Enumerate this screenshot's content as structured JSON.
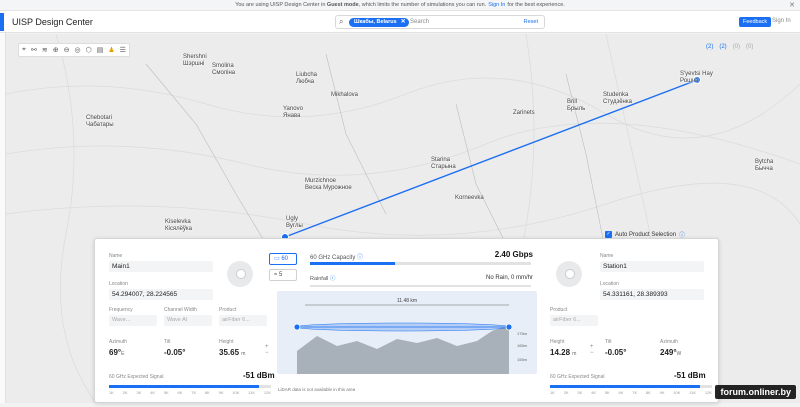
{
  "banner": {
    "prefix": "You are using UISP Design Center in",
    "mode": "Guest mode",
    "middle": ", which limits the number of simulations you can run.",
    "signin": "Sign In",
    "suffix": "for the best experience."
  },
  "app": {
    "title": "UISP Design Center",
    "feedback": "Feedback",
    "user": "Sign In"
  },
  "search": {
    "chip": "Шкабы, Belarus",
    "placeholder": "Search",
    "reset": "Reset"
  },
  "layers": [
    "(2)",
    "(2)",
    "(0)",
    "(0)"
  ],
  "places": [
    {
      "name": "Shershni",
      "alt": "Шэршні"
    },
    {
      "name": "Smolina",
      "alt": "Смоліна"
    },
    {
      "name": "Liubcha",
      "alt": "Любча"
    },
    {
      "name": "Mikhalova",
      "alt": "Міхалова"
    },
    {
      "name": "Yanovo",
      "alt": "Янава"
    },
    {
      "name": "Chebotari",
      "alt": "Чабатары"
    },
    {
      "name": "Zarinets",
      "alt": ""
    },
    {
      "name": "Brill",
      "alt": "Брыль"
    },
    {
      "name": "Studenka",
      "alt": "Студзёнка"
    },
    {
      "name": "S'yevtsi Hay",
      "alt": "Рошча"
    },
    {
      "name": "Starina",
      "alt": "Старына"
    },
    {
      "name": "Korneevka",
      "alt": ""
    },
    {
      "name": "Murzichnoe",
      "alt": "Веска Мурожное"
    },
    {
      "name": "Bytcha",
      "alt": "Бычча"
    },
    {
      "name": "Kiselevka",
      "alt": "Кісялёўка"
    },
    {
      "name": "Ugly",
      "alt": "Вуглы"
    }
  ],
  "panel": {
    "autoselect": "Auto Product Selection",
    "left": {
      "name_label": "Name",
      "name": "Main1",
      "location_label": "Location",
      "location": "54.294007, 28.224565",
      "freq_label": "Frequency",
      "freq": "Wave...",
      "width_label": "Channel Width",
      "width": "Wave AI",
      "product_label": "Product",
      "product": "airFiber 6...",
      "azimuth_label": "Azimuth",
      "azimuth": "69°",
      "azimuth_unit": "E",
      "tilt_label": "Tilt",
      "tilt": "-0.05°",
      "height_label": "Height",
      "height": "35.65",
      "height_unit": "m",
      "signal_label": "60 GHz Expected Signal",
      "signal": "-51 dBm"
    },
    "right": {
      "name_label": "Name",
      "name": "Station1",
      "location_label": "Location",
      "location": "54.331161, 28.389393",
      "product_label": "Product",
      "product": "airFiber 6...",
      "height_label": "Height",
      "height": "14.28",
      "height_unit": "m",
      "tilt_label": "Tilt",
      "tilt": "-0.05°",
      "azimuth_label": "Azimuth",
      "azimuth": "249°",
      "azimuth_unit": "W",
      "signal_label": "60 GHz Expected Signal",
      "signal": "-51 dBm"
    },
    "center": {
      "band": "60",
      "band_alt": "5",
      "capacity_label": "60 GHz Capacity",
      "capacity": "2.40 Gbps",
      "rainfall_label": "Rainfall",
      "rainfall": "No Rain, 0 mm/hr",
      "distance": "11.48 km",
      "elev_top": "175m",
      "elev_mid": "165m",
      "elev_low": "155m",
      "lidar": "LiDAR data is not available in this area"
    },
    "ticks": [
      "1K",
      "2K",
      "3K",
      "4K",
      "5K",
      "6K",
      "7K",
      "8K",
      "9K",
      "10K",
      "11K",
      "12K"
    ]
  },
  "watermark": "forum.onliner.by",
  "colors": {
    "accent": "#1b6ff2",
    "link_line": "#1b6ff2"
  }
}
